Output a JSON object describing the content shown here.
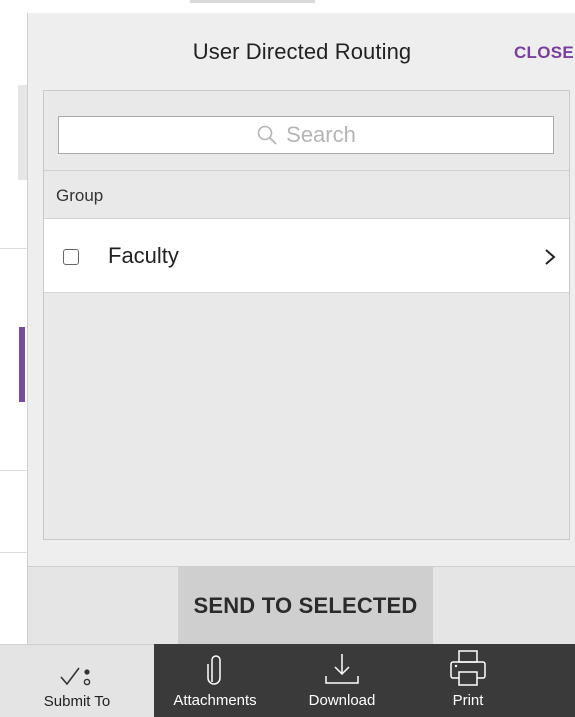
{
  "dialog": {
    "title": "User Directed Routing",
    "close_label": "CLOSE"
  },
  "search": {
    "placeholder": "Search"
  },
  "group": {
    "header": "Group",
    "items": [
      {
        "label": "Faculty",
        "checked": false
      }
    ]
  },
  "footer": {
    "send_label": "SEND TO SELECTED"
  },
  "toolbar": {
    "items": [
      {
        "label": "Submit To",
        "icon": "checkmark-dots-icon",
        "active": true
      },
      {
        "label": "Attachments",
        "icon": "paperclip-icon"
      },
      {
        "label": "Download",
        "icon": "download-icon"
      },
      {
        "label": "Print",
        "icon": "printer-icon"
      }
    ]
  },
  "colors": {
    "accent": "#7a3f9a",
    "toolbar_bg": "#3a3a3a",
    "modal_bg": "#eeeeee"
  }
}
